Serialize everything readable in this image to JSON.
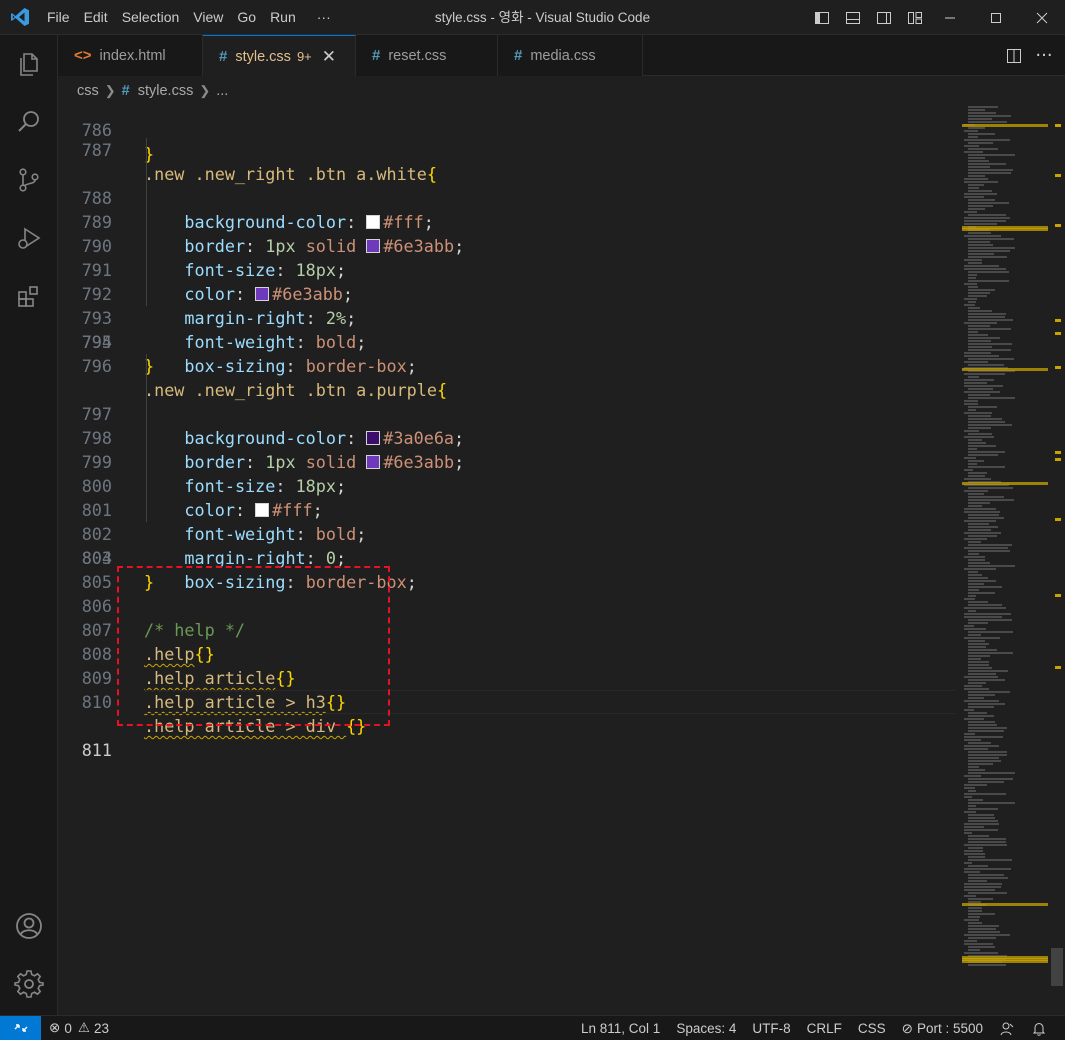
{
  "menu": [
    "File",
    "Edit",
    "Selection",
    "View",
    "Go",
    "Run",
    "···"
  ],
  "window_title": "style.css - 영화 - Visual Studio Code",
  "tabs": [
    {
      "label": "index.html",
      "icon": "html-icon",
      "glyph": "<>"
    },
    {
      "label": "style.css",
      "icon": "css-icon",
      "glyph": "#",
      "badge": "9+",
      "active": true
    },
    {
      "label": "reset.css",
      "icon": "css-icon",
      "glyph": "#"
    },
    {
      "label": "media.css",
      "icon": "css-icon",
      "glyph": "#"
    }
  ],
  "breadcrumb": {
    "folder": "css",
    "file": "style.css",
    "more": "..."
  },
  "code": {
    "l786": {
      "ln": "786",
      "text": "}"
    },
    "l787": {
      "ln": "787",
      "sel": ".new .new_right .btn a.white",
      "open": "{"
    },
    "l788": {
      "ln": "788",
      "prop": "background-color",
      "val": "#fff"
    },
    "l789": {
      "ln": "789",
      "prop": "border",
      "num": "1px",
      "kw": "solid",
      "val": "#6e3abb"
    },
    "l790": {
      "ln": "790",
      "prop": "font-size",
      "num": "18px"
    },
    "l791": {
      "ln": "791",
      "prop": "color",
      "val": "#6e3abb"
    },
    "l792": {
      "ln": "792",
      "prop": "margin-right",
      "num": "2%"
    },
    "l793": {
      "ln": "793",
      "prop": "font-weight",
      "val": "bold"
    },
    "l794": {
      "ln": "794",
      "prop": "box-sizing",
      "val": "border-box"
    },
    "l795": {
      "ln": "795",
      "close": "}"
    },
    "l796": {
      "ln": "796",
      "sel": ".new .new_right .btn a.purple",
      "open": "{"
    },
    "l797": {
      "ln": "797",
      "prop": "background-color",
      "val": "#3a0e6a"
    },
    "l798": {
      "ln": "798",
      "prop": "border",
      "num": "1px",
      "kw": "solid",
      "val": "#6e3abb"
    },
    "l799": {
      "ln": "799",
      "prop": "font-size",
      "num": "18px"
    },
    "l800": {
      "ln": "800",
      "prop": "color",
      "val": "#fff"
    },
    "l801": {
      "ln": "801",
      "prop": "font-weight",
      "val": "bold"
    },
    "l802": {
      "ln": "802",
      "prop": "margin-right",
      "num": "0"
    },
    "l803": {
      "ln": "803",
      "prop": "box-sizing",
      "val": "border-box"
    },
    "l804": {
      "ln": "804",
      "close": "}"
    },
    "l805": {
      "ln": "805"
    },
    "l806": {
      "ln": "806",
      "comment": "/* help */"
    },
    "l807": {
      "ln": "807",
      "sel": ".help",
      "braces": "{}"
    },
    "l808": {
      "ln": "808",
      "sel": ".help article",
      "braces": "{}"
    },
    "l809": {
      "ln": "809",
      "sel": ".help article > h3",
      "braces": "{}"
    },
    "l810": {
      "ln": "810",
      "sel": ".help article > div ",
      "braces": "{}"
    },
    "l811": {
      "ln": "811"
    }
  },
  "swatch_colors": {
    "white": "#ffffff",
    "purple_light": "#6e3abb",
    "purple_dark": "#3a0e6a"
  },
  "status": {
    "errors": "0",
    "warnings": "23",
    "position": "Ln 811, Col 1",
    "spaces": "Spaces: 4",
    "encoding": "UTF-8",
    "eol": "CRLF",
    "language": "CSS",
    "port": "Port : 5500"
  },
  "colors": {
    "accent": "#0078d4",
    "modified": "#e2c08d",
    "highlight_box": "#e81123"
  }
}
